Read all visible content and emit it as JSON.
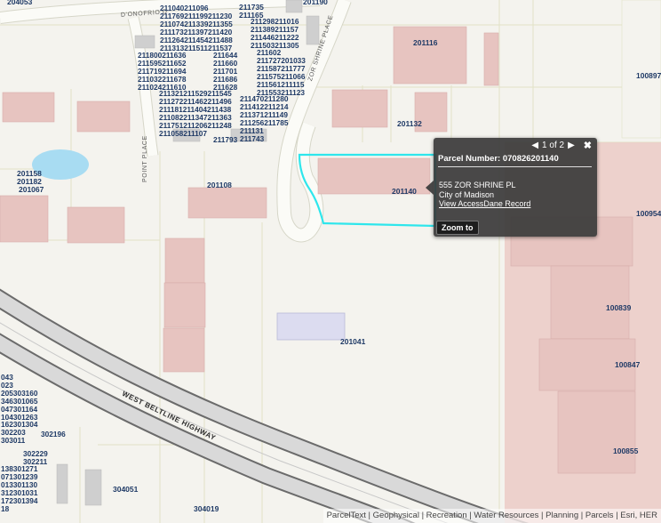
{
  "popup": {
    "nav_prev": "◀",
    "page_indicator": "1 of 2",
    "nav_next": "▶",
    "close": "✖",
    "title": "Parcel Number:  070826201140",
    "address": "555 ZOR SHRINE PL",
    "city": "City of Madison",
    "link": "View AccessDane Record",
    "zoom_button": "Zoom to"
  },
  "streets": {
    "donofrio": "D'ONOFRIO D",
    "zor_shrine": "ZOR SHRINE PLACE",
    "point_place": "POINT PLACE",
    "beltline": "WEST BELTLINE HIGHWAY"
  },
  "parcel_labels": {
    "p204053": "204053",
    "p201190": "201190",
    "p211735": "211735",
    "p211165": "211165",
    "p201116": "201116",
    "p100897": "100897",
    "p201132": "201132",
    "p201158": "201158",
    "p201182": "201182",
    "p201067": "201067",
    "p201108": "201108",
    "p201140": "201140",
    "p100954": "100954",
    "p100839": "100839",
    "p201041": "201041",
    "p100847": "100847",
    "p100855": "100855",
    "p304051": "304051",
    "p304019": "304019"
  },
  "dense_blocks": {
    "block1": "211040211096\n211769211199211230\n211074211339211355\n211173211397211420\n211264211454211488\n211313211511211537",
    "block2": "211298211016\n211389211157\n211446211222\n211503211305",
    "block3": "211800211636\n211595211652\n211719211694\n211032211678\n211024211610",
    "block4": "211644\n211660\n211701\n211686\n211628",
    "block5": "211602\n211727201033\n211587211777\n211575211066\n211561211115\n211553211123",
    "block6": "211321211529211545\n211272211462211496\n211181211404211438\n211082211347211363\n211751211206211248\n211058211107",
    "block7": "211793",
    "block8": "211470211280\n211412211214\n211371211149\n211256211785\n211131\n211743",
    "block9": "043\n023\n205303160\n346301065\n047301164\n104301263\n162301304\n302203\n303011",
    "block10": "302196",
    "block11": "302229\n302211",
    "block12": "138301271\n071301239\n013301130\n312301031\n172301394\n18",
    "block13": "301340"
  },
  "attribution": "ParcelText | Geophysical | Recreation | Water Resources | Planning | Parcels | Esri, HER"
}
